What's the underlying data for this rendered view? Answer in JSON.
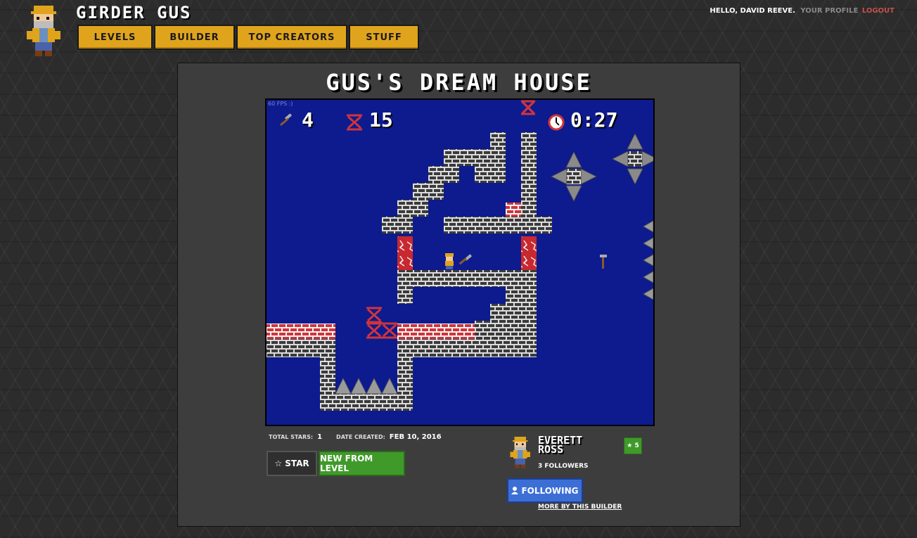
{
  "site": {
    "title": "GIRDER GUS"
  },
  "nav": [
    {
      "label": "LEVELS"
    },
    {
      "label": "BUILDER"
    },
    {
      "label": "TOP CREATORS"
    },
    {
      "label": "STUFF"
    }
  ],
  "user": {
    "hello": "HELLO, DAVID REEVE.",
    "profile": "YOUR PROFILE",
    "logout": "LOGOUT"
  },
  "level": {
    "title": "GUS'S DREAM HOUSE",
    "fps": "60 FPS :)",
    "hud": {
      "hammers": "4",
      "girders": "15",
      "timer": "0:27"
    },
    "total_stars_label": "TOTAL STARS:",
    "total_stars": "1",
    "date_created_label": "DATE CREATED:",
    "date_created": "FEB 10, 2016",
    "star_button": "☆ STAR",
    "new_button": "NEW FROM LEVEL"
  },
  "creator": {
    "name": "EVERETT ROSS",
    "stars": "★ 5",
    "followers": "3 FOLLOWERS",
    "follow_button": "FOLLOWING",
    "more_link": "MORE BY THIS BUILDER"
  },
  "colors": {
    "accent": "#e0a41c",
    "game_bg": "#0d1b8f",
    "brick": "#3a3a3a",
    "red_brick": "#d0343a",
    "green": "#3f9a2a",
    "blue": "#3b6fd6"
  },
  "icons": {
    "hammer": "hammer-icon",
    "girder": "girder-icon",
    "clock": "clock-icon",
    "user": "user-icon",
    "star": "star-icon"
  }
}
